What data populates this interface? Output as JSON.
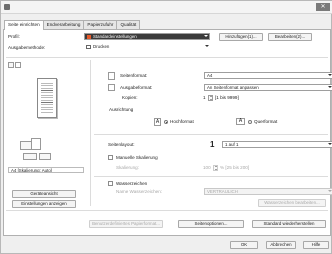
{
  "window": {
    "close_label": "✕"
  },
  "tabs": [
    {
      "label": "Seite einrichten"
    },
    {
      "label": "Endverarbeitung"
    },
    {
      "label": "Papierzufuhr"
    },
    {
      "label": "Qualität"
    }
  ],
  "profile": {
    "label": "Profil:",
    "value": "Standardeinstellungen",
    "add_button": "Hinzufügen(1)...",
    "edit_button": "Bearbeiten(2)..."
  },
  "output_method": {
    "label": "Ausgabemethode:",
    "value": "Drucken"
  },
  "preview": {
    "status": "A4 [Skalierung: Auto]"
  },
  "page_size": {
    "label": "Seitenformat:",
    "value": "A4"
  },
  "output_size": {
    "label": "Ausgabeformat:",
    "value": "An Seitenformat anpassen"
  },
  "copies": {
    "label": "Kopien:",
    "value": "1",
    "range": "[1 bis 9999]"
  },
  "orientation": {
    "label": "Ausrichtung",
    "portrait_letter": "A",
    "portrait": "Hochformat",
    "landscape_letter": "A",
    "landscape": "Querformat",
    "selected": "portrait"
  },
  "page_layout": {
    "label": "Seitenlayout:",
    "count": "1",
    "value": "1 auf 1"
  },
  "manual_scaling": {
    "label": "Manuelle Skalierung",
    "checked": false,
    "scaling_label": "Skalierung:",
    "value": "100",
    "range": "% [25 bis 200]"
  },
  "watermark": {
    "label": "Wasserzeichen",
    "checked": false,
    "name_label": "Name Wasserzeichen:",
    "value": "VERTRAULICH",
    "edit_button": "Wasserzeichen bearbeiten..."
  },
  "left_buttons": {
    "page_view": "Geräteansicht",
    "show_settings": "Einstellungen anzeigen"
  },
  "bottom_buttons": {
    "custom_paper": "Benutzerdefiniertes Papierformat...",
    "page_options": "Seitenoptionen...",
    "restore_defaults": "Standard wiederherstellen"
  },
  "dialog_buttons": {
    "ok": "OK",
    "cancel": "Abbrechen",
    "help": "Hilfe"
  }
}
